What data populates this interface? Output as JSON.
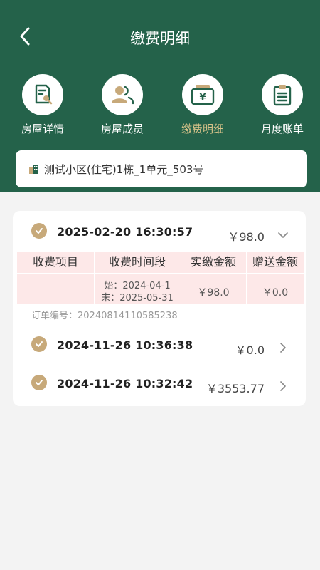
{
  "header": {
    "title": "缴费明细"
  },
  "nav": [
    {
      "label": "房屋详情",
      "icon": "house-detail-icon",
      "active": false
    },
    {
      "label": "房屋成员",
      "icon": "members-icon",
      "active": false
    },
    {
      "label": "缴费明细",
      "icon": "payment-icon",
      "active": true
    },
    {
      "label": "月度账单",
      "icon": "bill-icon",
      "active": false
    }
  ],
  "address": {
    "text": "测试小区(住宅)1栋_1单元_503号"
  },
  "payments": [
    {
      "datetime": "2025-02-20 16:30:57",
      "amount": "￥98.0",
      "expanded": true,
      "detail": {
        "headers": [
          "收费项目",
          "收费时间段",
          "实缴金额",
          "赠送金额"
        ],
        "item": "",
        "period_start": "始：2024-04-1",
        "period_end": "末：2025-05-31",
        "paid": "￥98.0",
        "gift": "￥0.0"
      },
      "order_label": "订单编号：",
      "order_no": "20240814110585238"
    },
    {
      "datetime": "2024-11-26 10:36:38",
      "amount": "￥0.0",
      "expanded": false
    },
    {
      "datetime": "2024-11-26 10:32:42",
      "amount": "￥3553.77",
      "expanded": false
    }
  ],
  "colors": {
    "primary": "#24624a",
    "accent": "#c7a97a",
    "active_label": "#d8c38a",
    "table_bg": "#fde8e8"
  }
}
